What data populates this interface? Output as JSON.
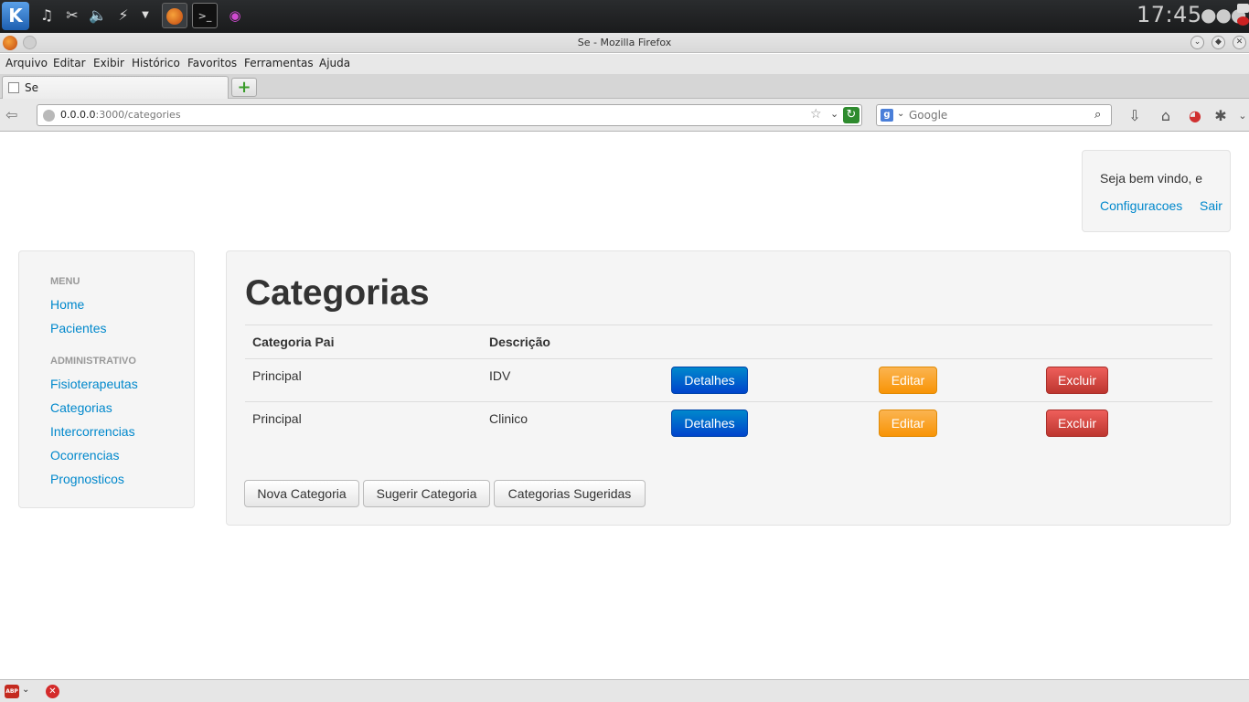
{
  "os_panel": {
    "start_glyph": "K",
    "clock": "17:45",
    "dots": "●●●"
  },
  "window": {
    "title": "Se - Mozilla Firefox"
  },
  "menubar": {
    "items": [
      "Arquivo",
      "Editar",
      "Exibir",
      "Histórico",
      "Favoritos",
      "Ferramentas",
      "Ajuda"
    ]
  },
  "tabs": {
    "active_label": "Se",
    "new_tab": "+"
  },
  "navbar": {
    "url_host": "0.0.0.0",
    "url_path": ":3000/categories",
    "search_placeholder": "Google"
  },
  "welcome": {
    "text": "Seja bem vindo, e",
    "settings_link": "Configuracoes",
    "logout_link": "Sair"
  },
  "sidebar": {
    "menu_header": "MENU",
    "menu_items": [
      "Home",
      "Pacientes"
    ],
    "admin_header": "ADMINISTRATIVO",
    "admin_items": [
      "Fisioterapeutas",
      "Categorias",
      "Intercorrencias",
      "Ocorrencias",
      "Prognosticos"
    ]
  },
  "main": {
    "title": "Categorias",
    "columns": [
      "Categoria Pai",
      "Descrição"
    ],
    "rows": [
      {
        "parent": "Principal",
        "description": "IDV"
      },
      {
        "parent": "Principal",
        "description": "Clinico"
      }
    ],
    "row_actions": {
      "details": "Detalhes",
      "edit": "Editar",
      "delete": "Excluir"
    },
    "footer_buttons": [
      "Nova Categoria",
      "Sugerir Categoria",
      "Categorias Sugeridas"
    ]
  },
  "colors": {
    "link": "#0088cc",
    "primary": "#0044cc",
    "warning": "#f89406",
    "danger": "#bd362f"
  }
}
